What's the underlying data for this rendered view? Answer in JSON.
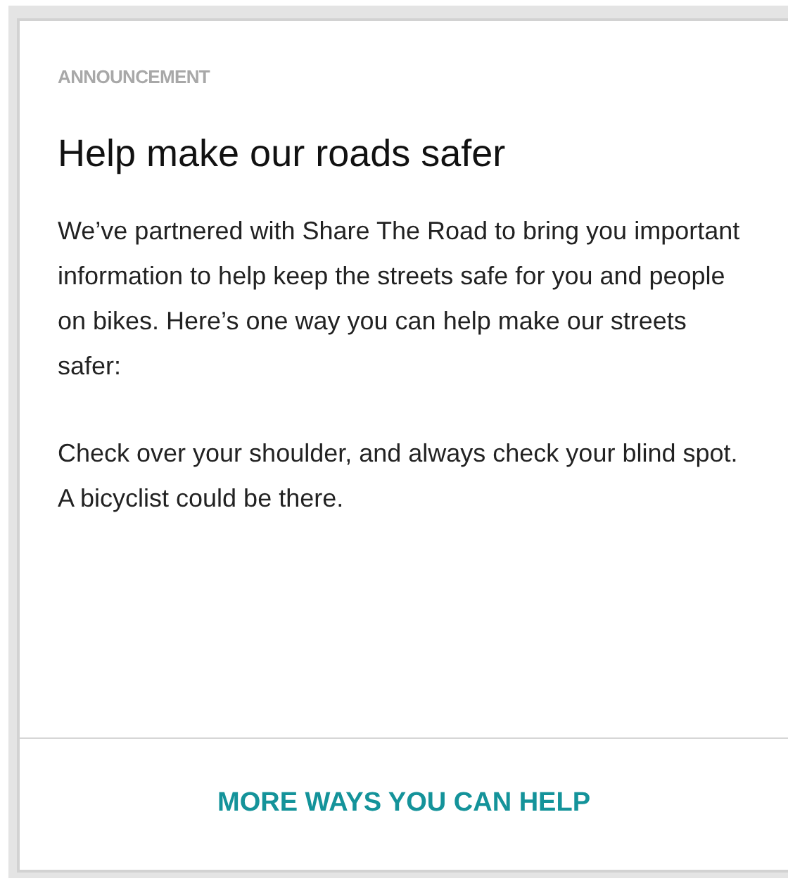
{
  "card": {
    "eyebrow": "ANNOUNCEMENT",
    "title": "Help make our roads safer",
    "paragraphs": [
      "We’ve partnered with Share The Road to bring you important information to help keep the streets safe for you and people on bikes. Here’s one way you can help make our streets safer:",
      "Check over your shoulder, and always check your blind spot. A bicyclist could be there."
    ],
    "action": "MORE WAYS YOU CAN HELP"
  }
}
